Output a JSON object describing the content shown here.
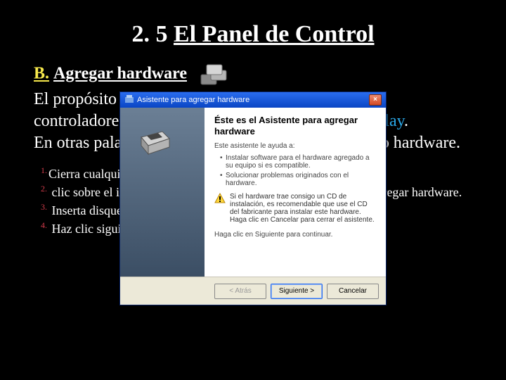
{
  "slide": {
    "heading_prefix": "2. 5 ",
    "heading_underlined": "El Panel de Control",
    "section_letter": "B.",
    "section_title": "Agregar hardware",
    "para1_a": "El propósito de este asistente es agregar/instalar los controladores de dispositivos sin tecnología ",
    "para1_pnp": "plug&play",
    "para1_b": ".",
    "para2": "En otras palabras, para que se reconozca el elemento hardware.",
    "steps": [
      "Cierra cualquier programa abierto.",
      "clic sobre el icono → siguiente → si → Agregar asistente para agregar hardware.",
      "Inserta disquete o CD-ROM que contiene el controlador.",
      "Haz clic siguiente → Finalizar."
    ]
  },
  "wizard": {
    "title": "Asistente para agregar hardware",
    "heading": "Éste es el Asistente para agregar hardware",
    "intro": "Este asistente le ayuda a:",
    "bullets": [
      "Instalar software para el hardware agregado a su equipo si es compatible.",
      "Solucionar problemas originados con el hardware."
    ],
    "warn_text": "Si el hardware trae consigo un CD de instalación, es recomendable que use el CD del fabricante para instalar este hardware. Haga clic en Cancelar para cerrar el asistente.",
    "continue_text": "Haga clic en Siguiente para continuar.",
    "btn_back": "< Atrás",
    "btn_next": "Siguiente >",
    "btn_cancel": "Cancelar"
  }
}
